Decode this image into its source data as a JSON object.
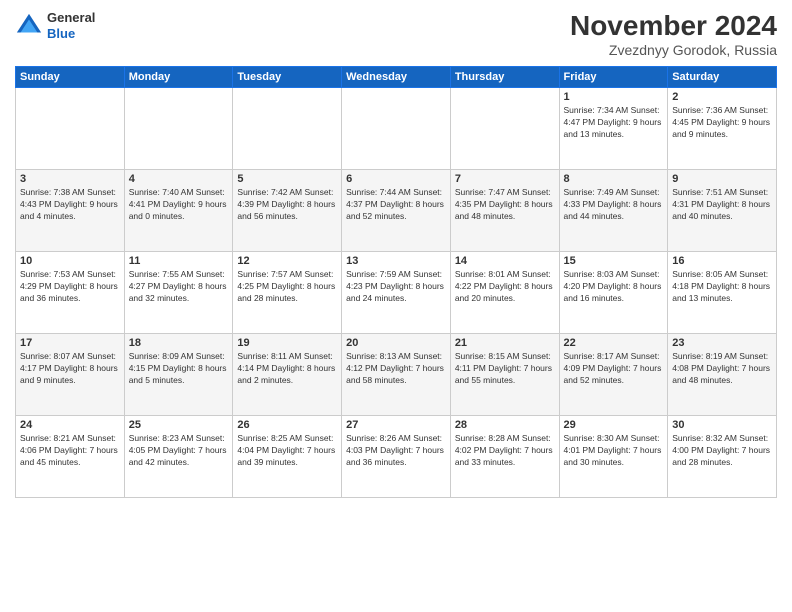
{
  "logo": {
    "general": "General",
    "blue": "Blue"
  },
  "title": "November 2024",
  "location": "Zvezdnyy Gorodok, Russia",
  "days_of_week": [
    "Sunday",
    "Monday",
    "Tuesday",
    "Wednesday",
    "Thursday",
    "Friday",
    "Saturday"
  ],
  "weeks": [
    [
      {
        "day": "",
        "info": ""
      },
      {
        "day": "",
        "info": ""
      },
      {
        "day": "",
        "info": ""
      },
      {
        "day": "",
        "info": ""
      },
      {
        "day": "",
        "info": ""
      },
      {
        "day": "1",
        "info": "Sunrise: 7:34 AM\nSunset: 4:47 PM\nDaylight: 9 hours and 13 minutes."
      },
      {
        "day": "2",
        "info": "Sunrise: 7:36 AM\nSunset: 4:45 PM\nDaylight: 9 hours and 9 minutes."
      }
    ],
    [
      {
        "day": "3",
        "info": "Sunrise: 7:38 AM\nSunset: 4:43 PM\nDaylight: 9 hours and 4 minutes."
      },
      {
        "day": "4",
        "info": "Sunrise: 7:40 AM\nSunset: 4:41 PM\nDaylight: 9 hours and 0 minutes."
      },
      {
        "day": "5",
        "info": "Sunrise: 7:42 AM\nSunset: 4:39 PM\nDaylight: 8 hours and 56 minutes."
      },
      {
        "day": "6",
        "info": "Sunrise: 7:44 AM\nSunset: 4:37 PM\nDaylight: 8 hours and 52 minutes."
      },
      {
        "day": "7",
        "info": "Sunrise: 7:47 AM\nSunset: 4:35 PM\nDaylight: 8 hours and 48 minutes."
      },
      {
        "day": "8",
        "info": "Sunrise: 7:49 AM\nSunset: 4:33 PM\nDaylight: 8 hours and 44 minutes."
      },
      {
        "day": "9",
        "info": "Sunrise: 7:51 AM\nSunset: 4:31 PM\nDaylight: 8 hours and 40 minutes."
      }
    ],
    [
      {
        "day": "10",
        "info": "Sunrise: 7:53 AM\nSunset: 4:29 PM\nDaylight: 8 hours and 36 minutes."
      },
      {
        "day": "11",
        "info": "Sunrise: 7:55 AM\nSunset: 4:27 PM\nDaylight: 8 hours and 32 minutes."
      },
      {
        "day": "12",
        "info": "Sunrise: 7:57 AM\nSunset: 4:25 PM\nDaylight: 8 hours and 28 minutes."
      },
      {
        "day": "13",
        "info": "Sunrise: 7:59 AM\nSunset: 4:23 PM\nDaylight: 8 hours and 24 minutes."
      },
      {
        "day": "14",
        "info": "Sunrise: 8:01 AM\nSunset: 4:22 PM\nDaylight: 8 hours and 20 minutes."
      },
      {
        "day": "15",
        "info": "Sunrise: 8:03 AM\nSunset: 4:20 PM\nDaylight: 8 hours and 16 minutes."
      },
      {
        "day": "16",
        "info": "Sunrise: 8:05 AM\nSunset: 4:18 PM\nDaylight: 8 hours and 13 minutes."
      }
    ],
    [
      {
        "day": "17",
        "info": "Sunrise: 8:07 AM\nSunset: 4:17 PM\nDaylight: 8 hours and 9 minutes."
      },
      {
        "day": "18",
        "info": "Sunrise: 8:09 AM\nSunset: 4:15 PM\nDaylight: 8 hours and 5 minutes."
      },
      {
        "day": "19",
        "info": "Sunrise: 8:11 AM\nSunset: 4:14 PM\nDaylight: 8 hours and 2 minutes."
      },
      {
        "day": "20",
        "info": "Sunrise: 8:13 AM\nSunset: 4:12 PM\nDaylight: 7 hours and 58 minutes."
      },
      {
        "day": "21",
        "info": "Sunrise: 8:15 AM\nSunset: 4:11 PM\nDaylight: 7 hours and 55 minutes."
      },
      {
        "day": "22",
        "info": "Sunrise: 8:17 AM\nSunset: 4:09 PM\nDaylight: 7 hours and 52 minutes."
      },
      {
        "day": "23",
        "info": "Sunrise: 8:19 AM\nSunset: 4:08 PM\nDaylight: 7 hours and 48 minutes."
      }
    ],
    [
      {
        "day": "24",
        "info": "Sunrise: 8:21 AM\nSunset: 4:06 PM\nDaylight: 7 hours and 45 minutes."
      },
      {
        "day": "25",
        "info": "Sunrise: 8:23 AM\nSunset: 4:05 PM\nDaylight: 7 hours and 42 minutes."
      },
      {
        "day": "26",
        "info": "Sunrise: 8:25 AM\nSunset: 4:04 PM\nDaylight: 7 hours and 39 minutes."
      },
      {
        "day": "27",
        "info": "Sunrise: 8:26 AM\nSunset: 4:03 PM\nDaylight: 7 hours and 36 minutes."
      },
      {
        "day": "28",
        "info": "Sunrise: 8:28 AM\nSunset: 4:02 PM\nDaylight: 7 hours and 33 minutes."
      },
      {
        "day": "29",
        "info": "Sunrise: 8:30 AM\nSunset: 4:01 PM\nDaylight: 7 hours and 30 minutes."
      },
      {
        "day": "30",
        "info": "Sunrise: 8:32 AM\nSunset: 4:00 PM\nDaylight: 7 hours and 28 minutes."
      }
    ]
  ]
}
